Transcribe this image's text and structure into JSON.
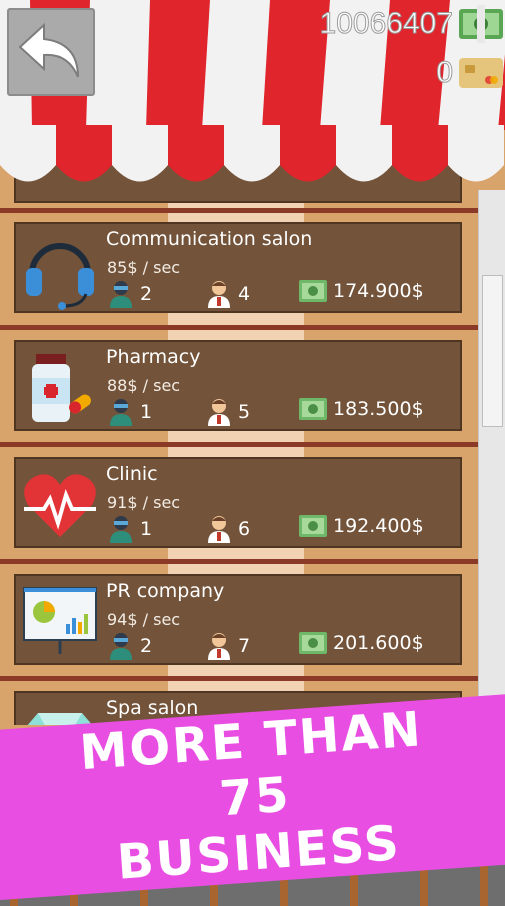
{
  "header": {
    "money": "10066407",
    "cards": "0"
  },
  "businesses": [
    {
      "name": "Communication salon",
      "rate": "85$ / sec",
      "workers": "2",
      "managers": "4",
      "price": "174.900$",
      "icon": "headset-icon"
    },
    {
      "name": "Pharmacy",
      "rate": "88$ / sec",
      "workers": "1",
      "managers": "5",
      "price": "183.500$",
      "icon": "medicine-bottle-icon"
    },
    {
      "name": "Clinic",
      "rate": "91$ / sec",
      "workers": "1",
      "managers": "6",
      "price": "192.400$",
      "icon": "heart-pulse-icon"
    },
    {
      "name": "PR company",
      "rate": "94$ / sec",
      "workers": "2",
      "managers": "7",
      "price": "201.600$",
      "icon": "presentation-board-icon"
    },
    {
      "name": "Spa salon",
      "icon": "gem-icon"
    }
  ],
  "banner": {
    "line1": "MORE THAN 75",
    "line2": "BUSINESS",
    "color": "#e94ee3"
  },
  "colors": {
    "awning_red": "#e1252d",
    "card_brown": "#735339",
    "wood": "#d9a46c"
  }
}
